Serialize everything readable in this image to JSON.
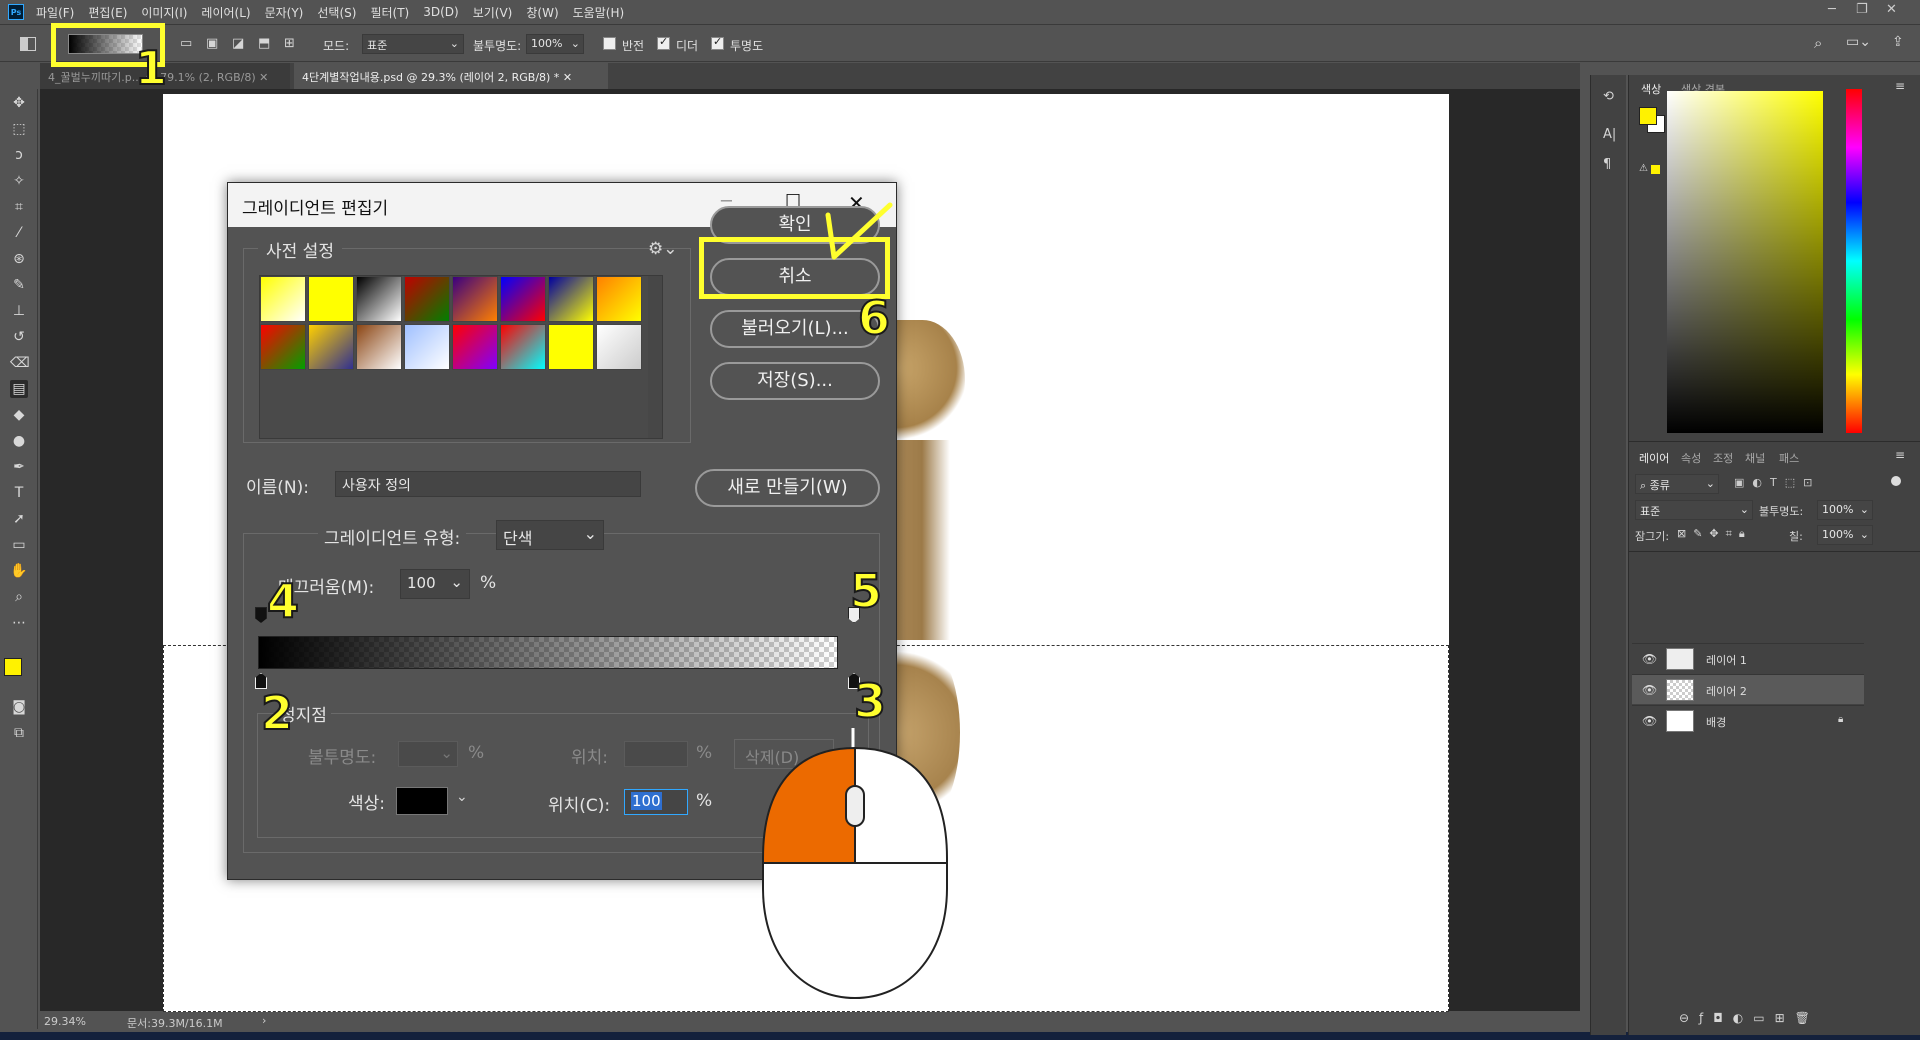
{
  "menubar": {
    "items": [
      "파일(F)",
      "편집(E)",
      "이미지(I)",
      "레이어(L)",
      "문자(Y)",
      "선택(S)",
      "필터(T)",
      "3D(D)",
      "보기(V)",
      "창(W)",
      "도움말(H)"
    ]
  },
  "options": {
    "mode_label": "모드:",
    "mode_value": "표준",
    "opacity_label": "불투명도:",
    "opacity_value": "100%",
    "reverse_label": "반전",
    "dither_label": "디더",
    "transparency_label": "투명도"
  },
  "tabs": [
    {
      "label": "4_꿀벌누끼따기.p... @ 79.1% (2, RGB/8)"
    },
    {
      "label": "4단계별작업내용.psd @ 29.3% (레이어 2, RGB/8) *"
    }
  ],
  "status": {
    "zoom": "29.34%",
    "doc": "문서:39.3M/16.1M"
  },
  "color_panel": {
    "tab1": "색상",
    "tab2": "색상 견본",
    "fg": "#fff200",
    "bg": "#ffffff"
  },
  "layers_panel": {
    "tabs": [
      "레이어",
      "속성",
      "조정",
      "채널",
      "패스"
    ],
    "filter": "종류",
    "blend": "표준",
    "opacity_label": "불투명도:",
    "opacity": "100%",
    "lock_label": "잠그기:",
    "fill_label": "칠:",
    "fill": "100%",
    "layers": [
      {
        "name": "레이어 1"
      },
      {
        "name": "레이어 2"
      },
      {
        "name": "배경"
      }
    ]
  },
  "dialog": {
    "title": "그레이디언트 편집기",
    "presets_label": "사전 설정",
    "ok": "확인",
    "cancel": "취소",
    "load": "불러오기(L)...",
    "save": "저장(S)...",
    "name_label": "이름(N):",
    "name_value": "사용자 정의",
    "new_button": "새로 만들기(W)",
    "type_label": "그레이디언트 유형:",
    "type_value": "단색",
    "smooth_label": "매끄러움(M):",
    "smooth_value": "100",
    "smooth_unit": "%",
    "stops_label": "정지점",
    "stop_opacity_label": "불투명도:",
    "stop_opacity_unit": "%",
    "stop_location_label": "위치:",
    "stop_location_unit": "%",
    "delete_label": "삭제(D)",
    "color_label": "색상:",
    "color_location_label": "위치(C):",
    "color_location_value": "100",
    "color_location_unit": "%",
    "stop_color": "#000000",
    "preset_colors": [
      [
        "#ffff00",
        "#ffffff"
      ],
      [
        "#ffff00",
        "#ffff00"
      ],
      [
        "#000000",
        "#ffffff"
      ],
      [
        "#c00000",
        "#008000"
      ],
      [
        "#3a0080",
        "#ff8000"
      ],
      [
        "#0000ff",
        "#ff0000"
      ],
      [
        "#0000a0",
        "#ffff00"
      ],
      [
        "#ff8000",
        "#ffff00"
      ],
      [
        "#ff0000",
        "#00a000"
      ],
      [
        "#ffd000",
        "#303090"
      ],
      [
        "#8b4513",
        "#ffffff"
      ],
      [
        "#a0c0ff",
        "#ffffff"
      ],
      [
        "#ff0000",
        "#8000ff"
      ],
      [
        "#ff0000",
        "#00ffff"
      ],
      [
        "#ffff00",
        "#ffff00"
      ],
      [
        "#ffffff",
        "#cccccc"
      ]
    ]
  },
  "annotations": [
    "1",
    "2",
    "3",
    "4",
    "5",
    "6"
  ]
}
